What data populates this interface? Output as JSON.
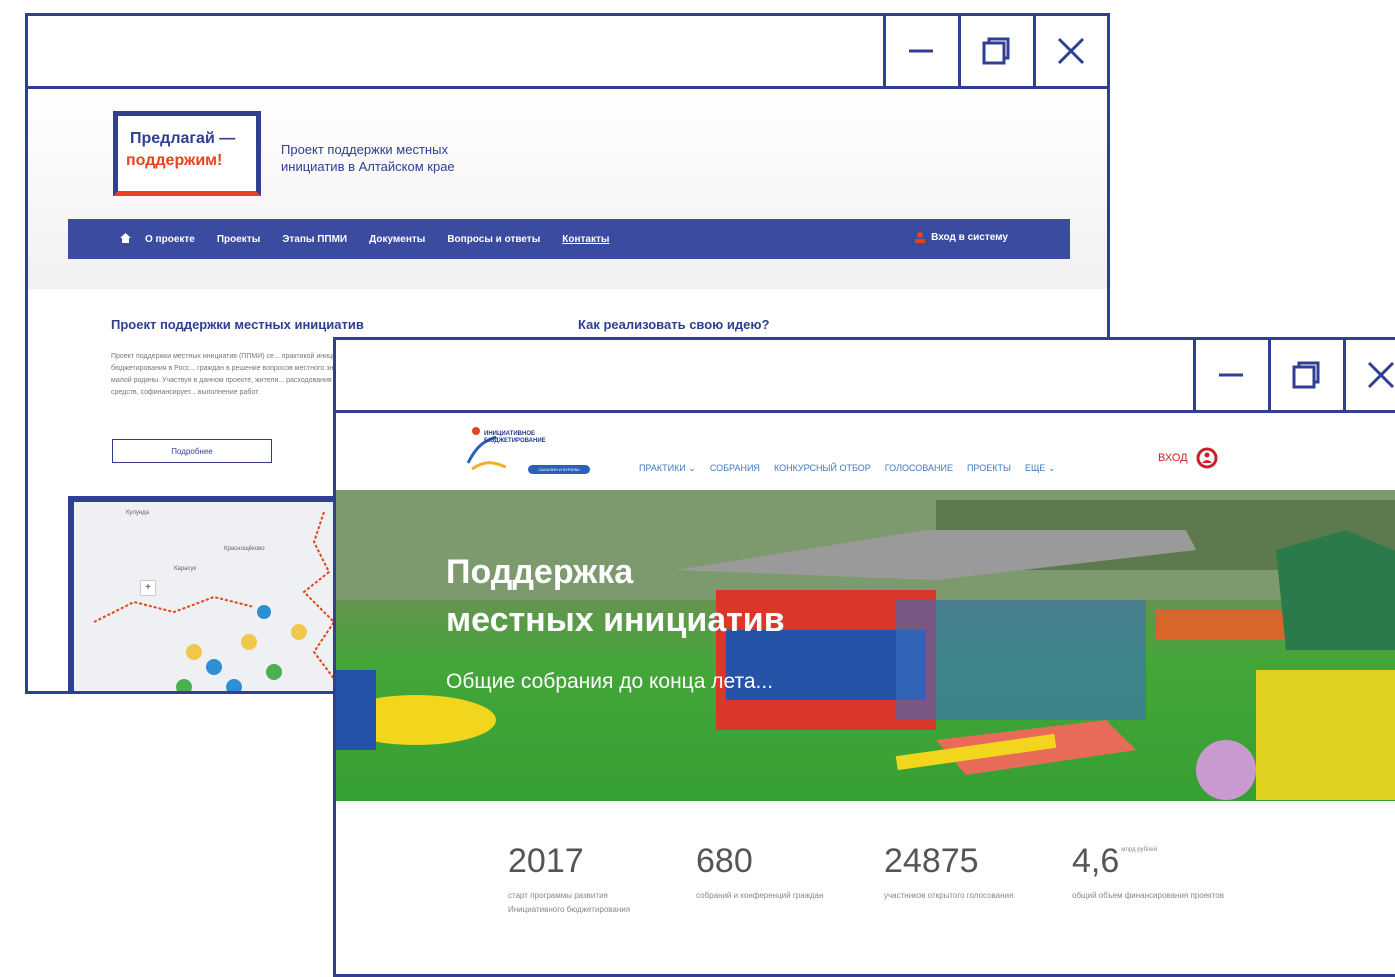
{
  "window1": {
    "logo_line1": "Предлагай —",
    "logo_line2": "поддержим!",
    "tagline_line1": "Проект поддержки местных",
    "tagline_line2": "инициатив в Алтайском крае",
    "nav": [
      "О проекте",
      "Проекты",
      "Этапы ППМИ",
      "Документы",
      "Вопросы и ответы",
      "Контакты"
    ],
    "login": "Вход в систему",
    "heading_left": "Проект поддержки местных инициатив",
    "heading_right": "Как реализовать свою идею?",
    "paragraph": "Проект поддержки местных инициатив (ППМИ) се... практикой инициативного бюджетирования в Росс... граждан в решение вопросов местного значения, ... малой родины. Участвуя в данном проекте, жители... расходования бюджетных средств, софинансирует... выполнение работ.",
    "more_button": "Подробнее",
    "map_cities": [
      "Кулунда",
      "Краснощёково",
      "Карасук"
    ]
  },
  "window2": {
    "logo_text_line1": "ИНИЦИАТИВНОЕ",
    "logo_text_line2": "БЮДЖЕТИРОВАНИЕ",
    "logo_pill": "САХАЛИН И КУРИЛЫ",
    "menu": [
      "ПРАКТИКИ ⌄",
      "СОБРАНИЯ",
      "КОНКУРСНЫЙ ОТБОР",
      "ГОЛОСОВАНИЕ",
      "ПРОЕКТЫ",
      "ЕЩЕ ⌄"
    ],
    "login": "ВХОД",
    "hero_title_line1": "Поддержка",
    "hero_title_line2": "местных инициатив",
    "hero_subtitle": "Общие собрания до конца лета...",
    "stats": [
      {
        "value": "2017",
        "label": "старт программы развития Инициативного бюджетирования"
      },
      {
        "value": "680",
        "label": "собраний и конференций граждан"
      },
      {
        "value": "24875",
        "label": "участников открытого голосования"
      },
      {
        "value": "4,6",
        "sup": "млрд рублей",
        "label": "общий объем финансирования проектов"
      }
    ]
  },
  "colors": {
    "frame": "#2f3f93",
    "accent_red": "#e5431d",
    "nav_bg": "#3a4ba0"
  }
}
